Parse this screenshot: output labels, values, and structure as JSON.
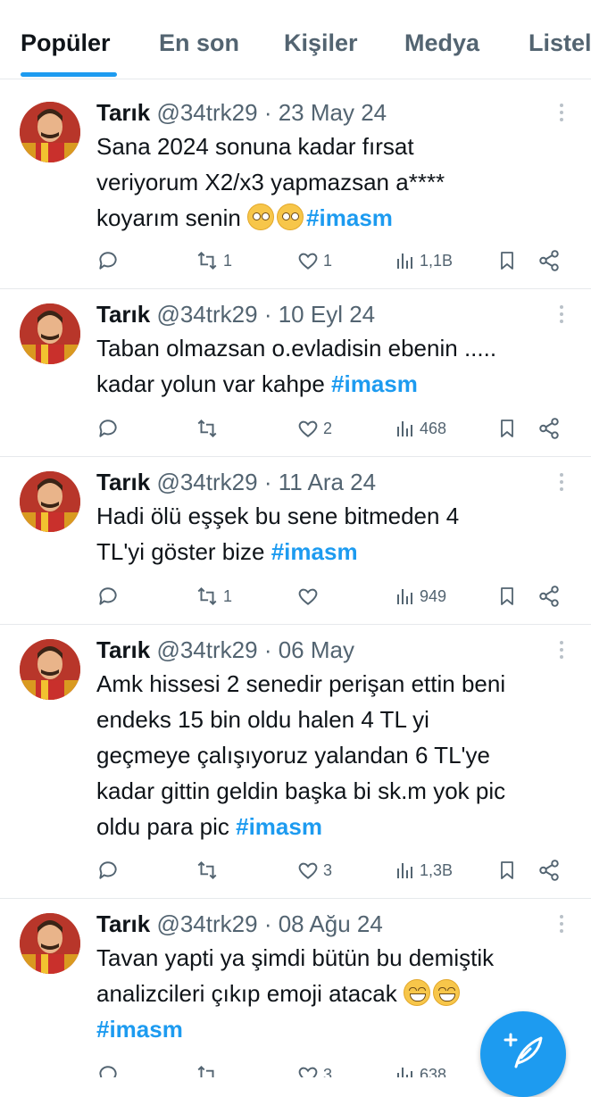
{
  "tabs": [
    {
      "label": "Popüler",
      "active": true
    },
    {
      "label": "En son",
      "active": false
    },
    {
      "label": "Kişiler",
      "active": false
    },
    {
      "label": "Medya",
      "active": false
    },
    {
      "label": "Listel",
      "active": false
    }
  ],
  "colors": {
    "accent": "#1d9bf0",
    "text": "#0f1419",
    "muted": "#536471",
    "divider": "#e6e9ec"
  },
  "tweets": [
    {
      "name": "Tarık",
      "handle": "@34trk29",
      "dot": "·",
      "date": "23 May 24",
      "text_lines": [
        "Sana 2024 sonuna kadar fırsat",
        "veriyorum X2/x3 yapmazsan a****",
        "koyarım senin "
      ],
      "emojis": [
        "face-with-monocle",
        "face-with-monocle"
      ],
      "hashtag": "#imasm",
      "reply": "",
      "retweet": "1",
      "like": "1",
      "views": "1,1B"
    },
    {
      "name": "Tarık",
      "handle": "@34trk29",
      "dot": "·",
      "date": "10 Eyl 24",
      "text_lines": [
        "Taban olmazsan o.evladisin ebenin .....",
        "kadar yolun var  kahpe "
      ],
      "emojis": [],
      "hashtag": "#imasm",
      "reply": "",
      "retweet": "",
      "like": "2",
      "views": "468"
    },
    {
      "name": "Tarık",
      "handle": "@34trk29",
      "dot": "·",
      "date": "11 Ara 24",
      "text_lines": [
        "Hadi ölü eşşek bu sene bitmeden 4",
        "TL'yi göster bize "
      ],
      "emojis": [],
      "hashtag": "#imasm",
      "reply": "",
      "retweet": "1",
      "like": "",
      "views": "949"
    },
    {
      "name": "Tarık",
      "handle": "@34trk29",
      "dot": "·",
      "date": "06 May",
      "text_lines": [
        "Amk hissesi 2 senedir perişan ettin beni",
        "endeks 15 bin oldu halen 4 TL yi",
        "geçmeye çalışıyoruz yalandan 6 TL'ye",
        "kadar gittin geldin başka bi sk.m yok pic",
        "oldu para pic "
      ],
      "emojis": [],
      "hashtag": "#imasm",
      "reply": "",
      "retweet": "",
      "like": "3",
      "views": "1,3B"
    },
    {
      "name": "Tarık",
      "handle": "@34trk29",
      "dot": "·",
      "date": "08 Ağu 24",
      "text_lines": [
        "Tavan yapti ya şimdi bütün bu demiştik",
        "analizcileri çıkıp emoji atacak "
      ],
      "emojis_line2": [
        "grinning-face",
        "grinning-face"
      ],
      "hashtag_line": "#imasm",
      "reply": "",
      "retweet": "",
      "like": "3",
      "views": "638"
    }
  ],
  "fab": {
    "icon": "compose-plus-feather-icon"
  }
}
